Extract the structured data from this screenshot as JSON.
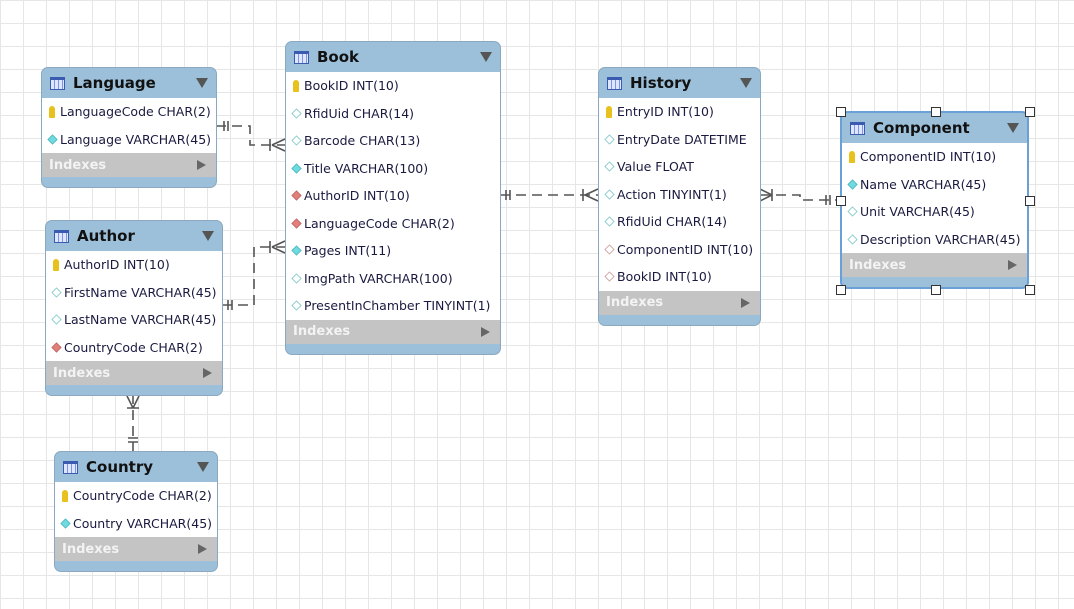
{
  "indexes_label": "Indexes",
  "tables": [
    {
      "id": "language",
      "name": "Language",
      "columns": [
        {
          "text": "LanguageCode CHAR(2)",
          "icon": "key"
        },
        {
          "text": "Language VARCHAR(45)",
          "icon": "cf"
        }
      ]
    },
    {
      "id": "book",
      "name": "Book",
      "columns": [
        {
          "text": "BookID INT(10)",
          "icon": "key"
        },
        {
          "text": "RfidUid CHAR(14)",
          "icon": "ch"
        },
        {
          "text": "Barcode CHAR(13)",
          "icon": "ch"
        },
        {
          "text": "Title VARCHAR(100)",
          "icon": "cf"
        },
        {
          "text": "AuthorID INT(10)",
          "icon": "rf"
        },
        {
          "text": "LanguageCode CHAR(2)",
          "icon": "rf"
        },
        {
          "text": "Pages INT(11)",
          "icon": "cf"
        },
        {
          "text": "ImgPath VARCHAR(100)",
          "icon": "ch"
        },
        {
          "text": "PresentInChamber TINYINT(1)",
          "icon": "ch"
        }
      ]
    },
    {
      "id": "history",
      "name": "History",
      "columns": [
        {
          "text": "EntryID INT(10)",
          "icon": "key"
        },
        {
          "text": "EntryDate DATETIME",
          "icon": "ch"
        },
        {
          "text": "Value FLOAT",
          "icon": "ch"
        },
        {
          "text": "Action TINYINT(1)",
          "icon": "ch"
        },
        {
          "text": "RfidUid CHAR(14)",
          "icon": "ch"
        },
        {
          "text": "ComponentID INT(10)",
          "icon": "rh"
        },
        {
          "text": "BookID INT(10)",
          "icon": "rh"
        }
      ]
    },
    {
      "id": "component",
      "name": "Component",
      "selected": true,
      "columns": [
        {
          "text": "ComponentID INT(10)",
          "icon": "key"
        },
        {
          "text": "Name VARCHAR(45)",
          "icon": "cf"
        },
        {
          "text": "Unit VARCHAR(45)",
          "icon": "ch"
        },
        {
          "text": "Description VARCHAR(45)",
          "icon": "ch"
        }
      ]
    },
    {
      "id": "author",
      "name": "Author",
      "columns": [
        {
          "text": "AuthorID INT(10)",
          "icon": "key"
        },
        {
          "text": "FirstName VARCHAR(45)",
          "icon": "ch"
        },
        {
          "text": "LastName VARCHAR(45)",
          "icon": "ch"
        },
        {
          "text": "CountryCode CHAR(2)",
          "icon": "rf"
        }
      ]
    },
    {
      "id": "country",
      "name": "Country",
      "columns": [
        {
          "text": "CountryCode CHAR(2)",
          "icon": "key"
        },
        {
          "text": "Country VARCHAR(45)",
          "icon": "cf"
        }
      ]
    }
  ],
  "relationships": [
    {
      "from": "language",
      "to": "book",
      "type": "one-to-many"
    },
    {
      "from": "author",
      "to": "book",
      "type": "one-to-many"
    },
    {
      "from": "book",
      "to": "history",
      "type": "one-to-many"
    },
    {
      "from": "component",
      "to": "history",
      "type": "one-to-many"
    },
    {
      "from": "country",
      "to": "author",
      "type": "one-to-many"
    }
  ]
}
